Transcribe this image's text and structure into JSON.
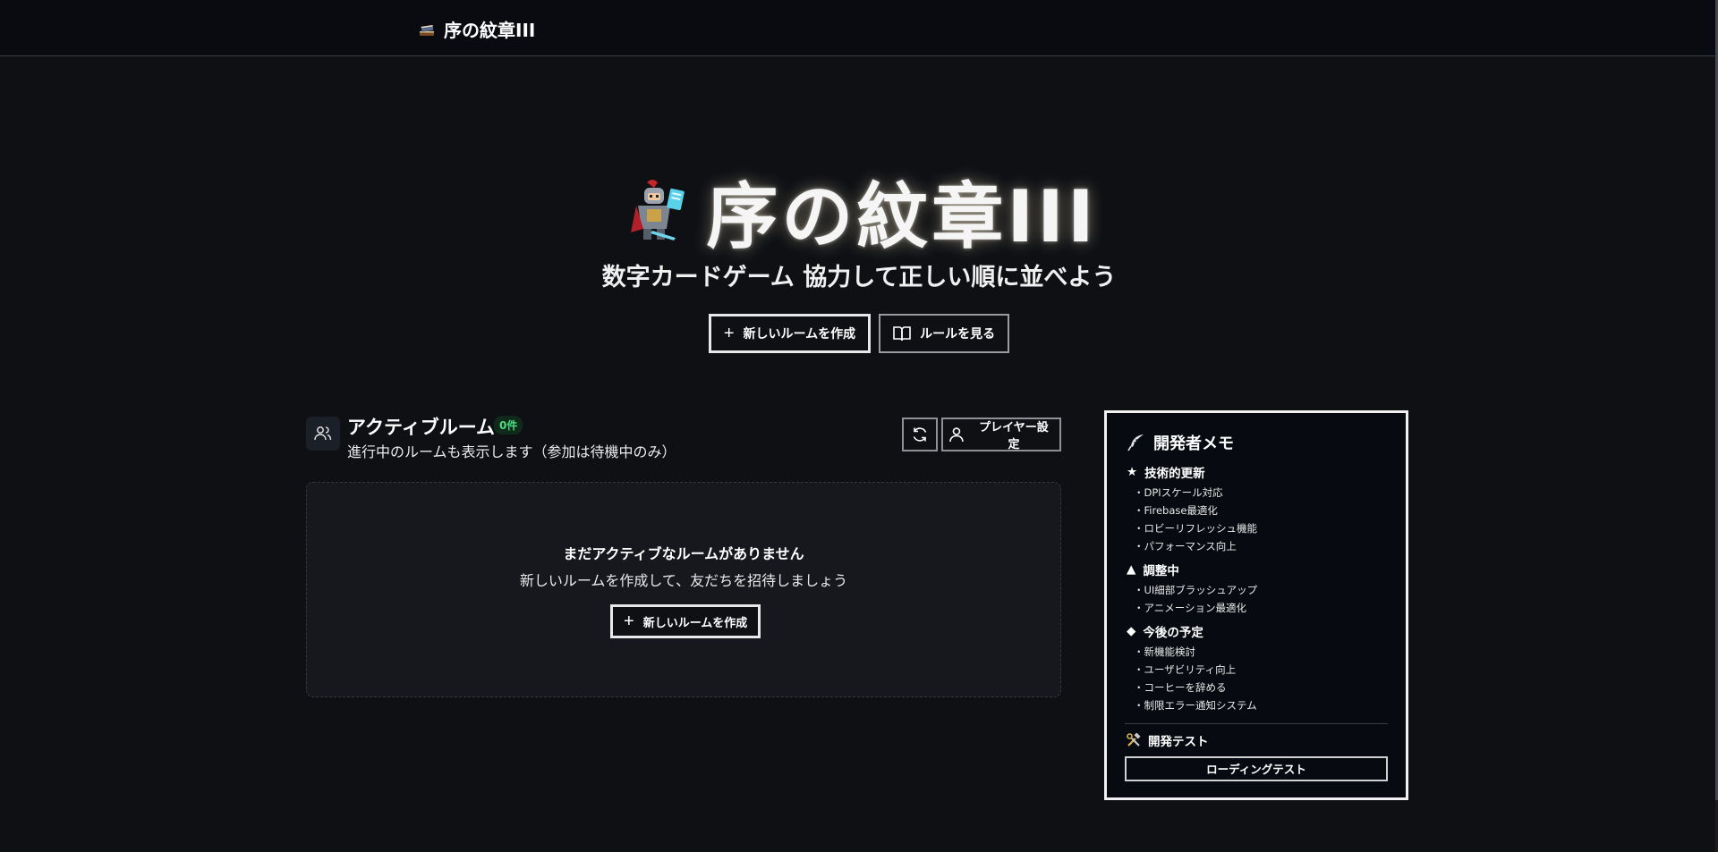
{
  "app": {
    "brand_title": "序の紋章III"
  },
  "hero": {
    "title": "序の紋章III",
    "subtitle": "数字カードゲーム 協力して正しい順に並べよう",
    "create_room_label": "新しいルームを作成",
    "rules_label": "ルールを見る"
  },
  "rooms": {
    "title": "アクティブルーム",
    "count_badge": "0件",
    "description": "進行中のルームも表示します（参加は待機中のみ）",
    "player_settings_label": "プレイヤー設定",
    "empty_title": "まだアクティブなルームがありません",
    "empty_description": "新しいルームを作成して、友だちを招待しましょう",
    "empty_create_label": "新しいルームを作成"
  },
  "dev_memo": {
    "title": "開発者メモ",
    "sections": [
      {
        "marker": "★",
        "title": "技術的更新",
        "items": [
          "DPIスケール対応",
          "Firebase最適化",
          "ロビーリフレッシュ機能",
          "パフォーマンス向上"
        ]
      },
      {
        "marker": "▲",
        "title": "調整中",
        "items": [
          "UI細部ブラッシュアップ",
          "アニメーション最適化"
        ]
      },
      {
        "marker": "◆",
        "title": "今後の予定",
        "items": [
          "新機能検討",
          "ユーザビリティ向上",
          "コーヒーを辞める",
          "制限エラー通知システム"
        ]
      }
    ],
    "dev_test_title": "開発テスト",
    "loading_test_label": "ローディングテスト"
  },
  "icons": {
    "brand": "book-stack-icon",
    "hero": "knight-icon",
    "create": "plus-icon",
    "rules": "book-open-icon",
    "rooms": "users-icon",
    "refresh": "refresh-icon",
    "player": "user-icon",
    "memo": "feather-icon",
    "dev_test": "tools-icon"
  },
  "colors": {
    "background": "#0e1014",
    "topbar": "#090b10",
    "badge_text": "#4ade80",
    "badge_bg": "#0f2a1a",
    "memo_bg": "#070a10"
  }
}
